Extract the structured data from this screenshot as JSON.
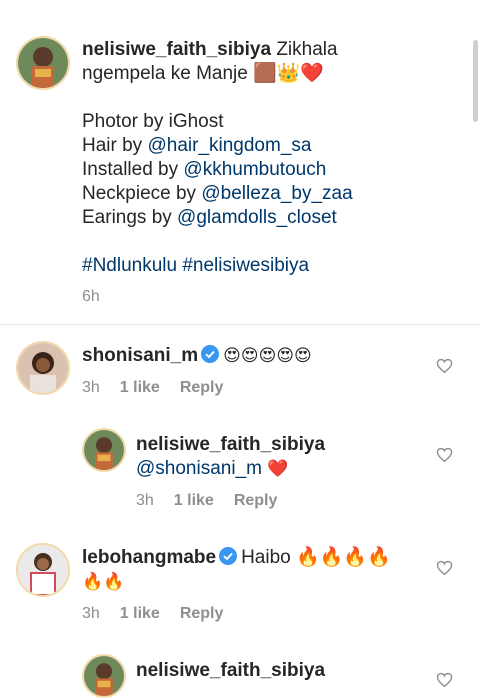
{
  "post": {
    "username": "nelisiwe_faith_sibiya",
    "caption_line1": "Zikhala",
    "caption_line2": "ngempela ke Manje",
    "caption_emoji": "🟫👑❤️",
    "credits": [
      {
        "label": "Photor by iGhost",
        "mention": ""
      },
      {
        "label": "Hair by ",
        "mention": "@hair_kingdom_sa"
      },
      {
        "label": "Installed by ",
        "mention": "@kkhumbutouch"
      },
      {
        "label": "Neckpiece by ",
        "mention": "@belleza_by_zaa"
      },
      {
        "label": "Earings by ",
        "mention": "@glamdolls_closet"
      }
    ],
    "hashtags": "#Ndlunkulu #nelisiwesibiya",
    "time": "6h"
  },
  "comments": [
    {
      "username": "shonisani_m",
      "verified": true,
      "text": "😍😍😍😍😍",
      "time": "3h",
      "likes": "1 like",
      "reply": "Reply"
    },
    {
      "username": "nelisiwe_faith_sibiya",
      "mention": "@shonisani_m",
      "text": "❤️",
      "time": "3h",
      "likes": "1 like",
      "reply": "Reply"
    },
    {
      "username": "lebohangmabe",
      "verified": true,
      "text_line1": "Haibo 🔥🔥🔥🔥",
      "text_line2": "🔥🔥",
      "time": "3h",
      "likes": "1 like",
      "reply": "Reply"
    },
    {
      "username": "nelisiwe_faith_sibiya"
    }
  ],
  "colors": {
    "link": "#00376b",
    "meta": "#8e8e8e",
    "verified": "#3897f0"
  }
}
